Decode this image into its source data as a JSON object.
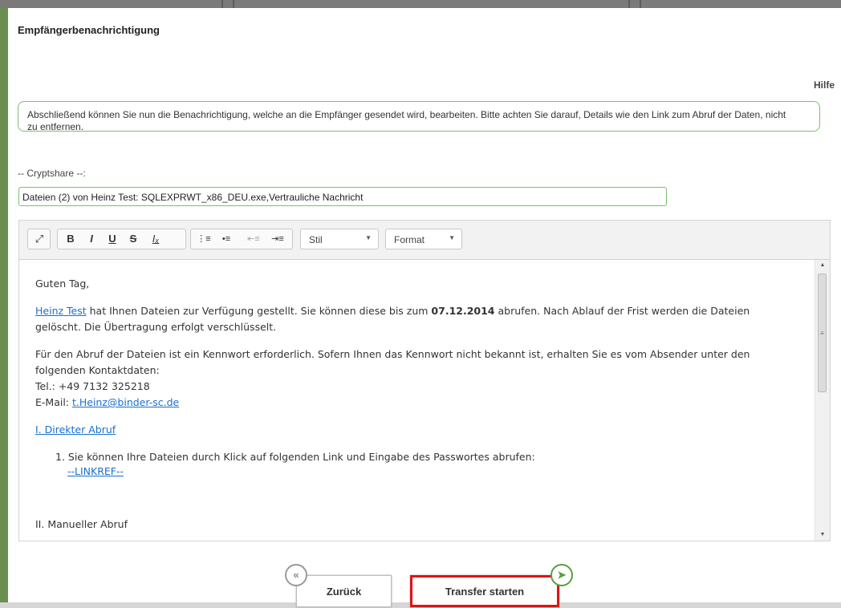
{
  "dialog": {
    "title": "Empfängerbenachrichtigung",
    "help": "Hilfe",
    "info": "Abschließend können Sie nun die Benachrichtigung, welche an die Empfänger gesendet wird, bearbeiten. Bitte achten Sie darauf, Details wie den Link zum Abruf der Daten, nicht zu entfernen."
  },
  "subject": {
    "label": "-- Cryptshare --:",
    "value": "Dateien (2) von Heinz Test: SQLEXPRWT_x86_DEU.exe,Vertrauliche Nachricht"
  },
  "toolbar": {
    "style_label": "Stil",
    "format_label": "Format",
    "icons": [
      "maximize-icon",
      "bold-icon",
      "italic-icon",
      "underline-icon",
      "strikethrough-icon",
      "remove-format-icon",
      "numbered-list-icon",
      "bulleted-list-icon",
      "outdent-icon",
      "indent-icon"
    ]
  },
  "content": {
    "greeting": "Guten Tag,",
    "sender_name": "Heinz Test",
    "p1_a": " hat Ihnen Dateien zur Verfügung gestellt. Sie können diese bis zum ",
    "p1_date": "07.12.2014",
    "p1_b": " abrufen. Nach Ablauf der Frist werden die Dateien gelöscht. Die Übertragung erfolgt verschlüsselt.",
    "p2_line1": "Für den Abruf der Dateien ist ein Kennwort erforderlich. Sofern Ihnen das Kennwort nicht bekannt ist, erhalten Sie es vom Absender unter den folgenden Kontaktdaten:",
    "tel": "Tel.: +49 7132 325218",
    "email_label": "E-Mail: ",
    "email": "t.Heinz@binder-sc.de",
    "section1": "I. Direkter Abruf",
    "item1": "1. Sie können Ihre Dateien durch Klick auf folgenden Link und Eingabe des Passwortes abrufen:",
    "linkref": "--LINKREF--",
    "section2": "II. Manueller Abruf"
  },
  "nav": {
    "back": "Zurück",
    "start": "Transfer starten"
  }
}
